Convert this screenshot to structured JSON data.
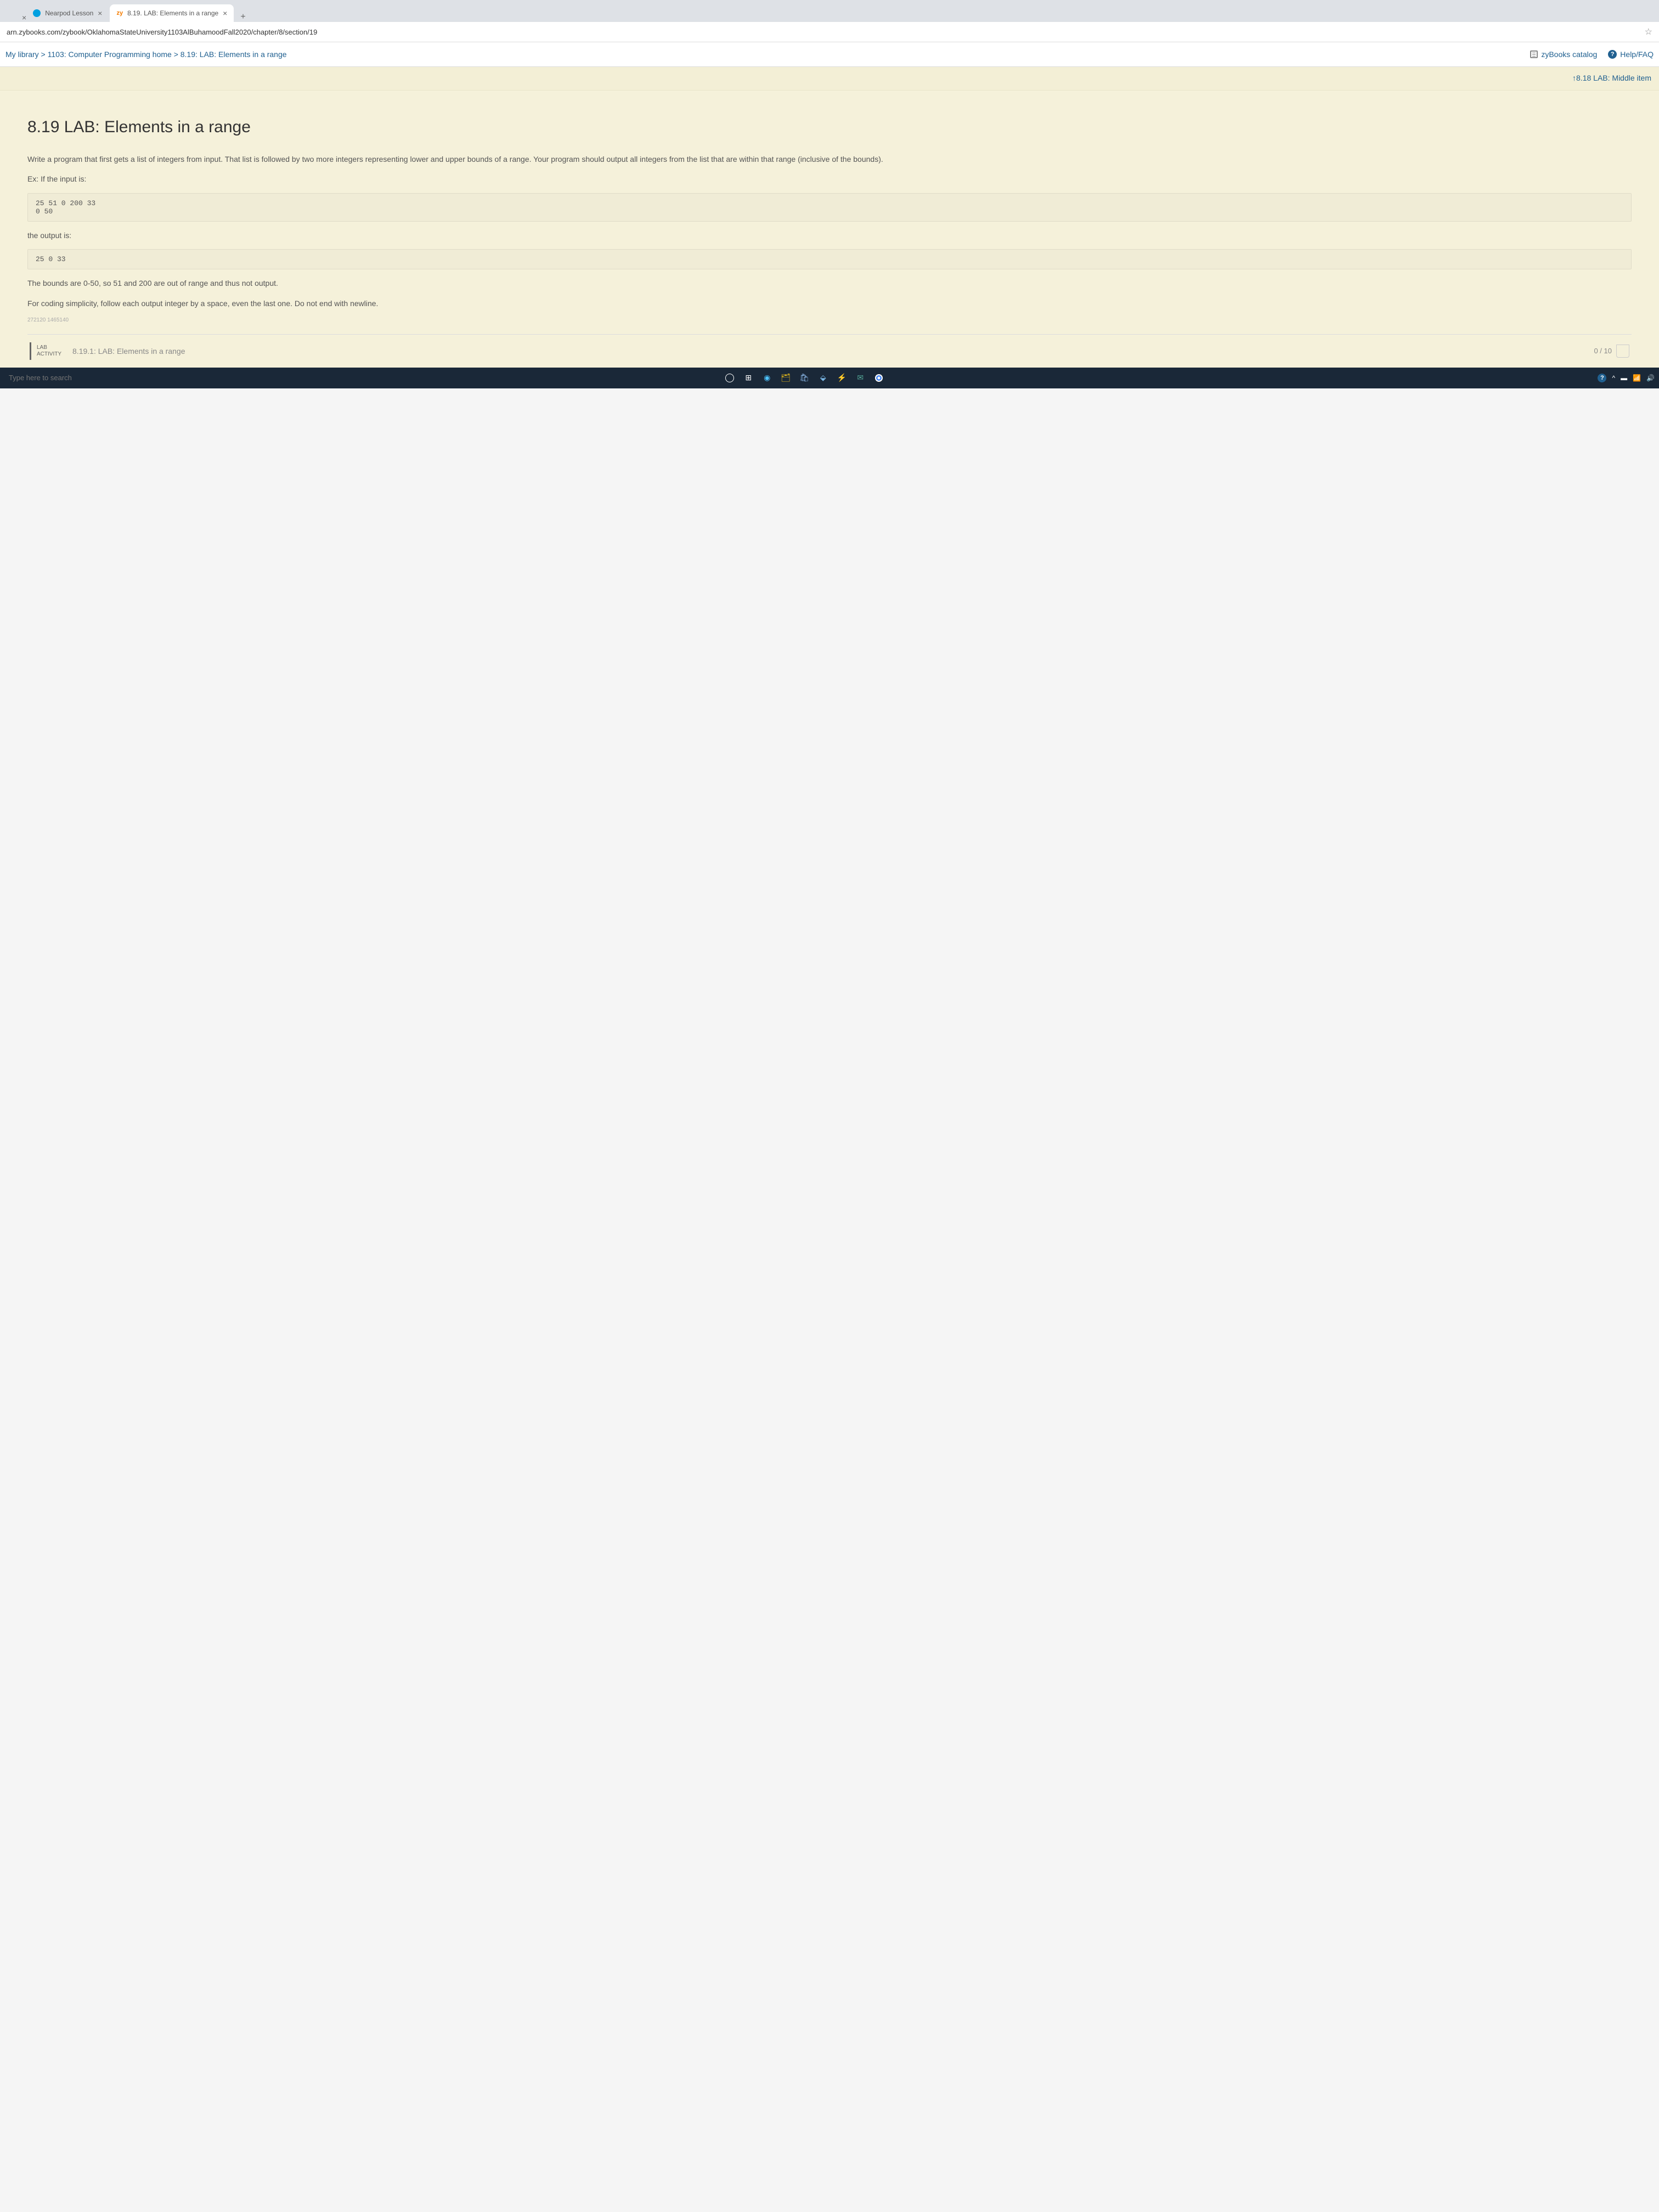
{
  "tabs": [
    {
      "label": "Nearpod Lesson",
      "icon": "nearpod"
    },
    {
      "label": "8.19. LAB: Elements in a range",
      "icon": "zy"
    }
  ],
  "url": "arn.zybooks.com/zybook/OklahomaStateUniversity1103AlBuhamoodFall2020/chapter/8/section/19",
  "breadcrumb": "My library > 1103: Computer Programming home > 8.19: LAB: Elements in a range",
  "catalog_label": "zyBooks catalog",
  "help_label": "Help/FAQ",
  "prev_link": "↑8.18 LAB: Middle item",
  "page_title": "8.19 LAB: Elements in a range",
  "intro": "Write a program that first gets a list of integers from input. That list is followed by two more integers representing lower and upper bounds of a range. Your program should output all integers from the list that are within that range (inclusive of the bounds).",
  "ex_label": "Ex: If the input is:",
  "input_block": "25 51 0 200 33\n0 50",
  "output_label": "the output is:",
  "output_block": "25 0 33",
  "note1": "The bounds are 0-50, so 51 and 200 are out of range and thus not output.",
  "note2": "For coding simplicity, follow each output integer by a space, even the last one. Do not end with newline.",
  "watermark": "272120 1465140",
  "activity": {
    "badge_line1": "LAB",
    "badge_line2": "ACTIVITY",
    "title": "8.19.1: LAB: Elements in a range",
    "score": "0 / 10"
  },
  "taskbar": {
    "search_placeholder": "Type here to search"
  }
}
